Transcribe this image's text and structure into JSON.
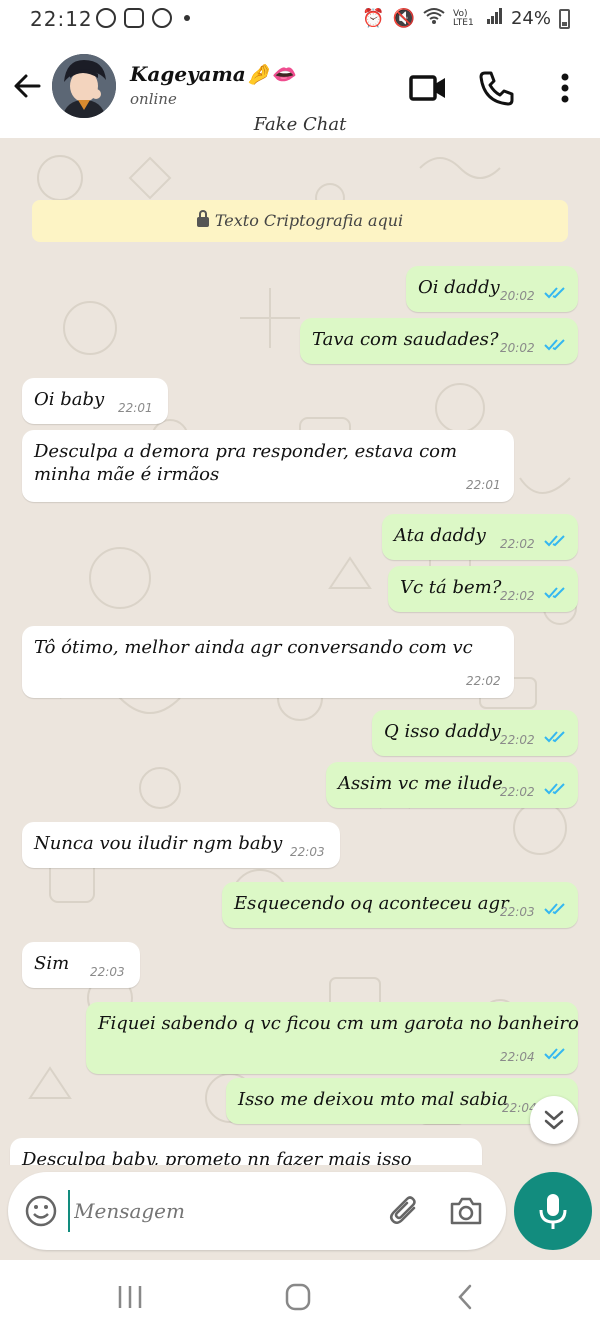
{
  "status_bar": {
    "time": "22:12",
    "network": "Vo) LTE1",
    "battery": "24%"
  },
  "header": {
    "contact_name": "Kageyama🤌👄",
    "contact_status": "online",
    "subtitle": "Fake Chat"
  },
  "chat": {
    "encryption_notice": "Texto Criptografia aqui",
    "messages": [
      {
        "dir": "out",
        "text": "Oi daddy",
        "time": "20:02"
      },
      {
        "dir": "out",
        "text": "Tava com saudades?",
        "time": "20:02"
      },
      {
        "dir": "in",
        "text": "Oi baby",
        "time": "22:01"
      },
      {
        "dir": "in",
        "text": "Desculpa a demora pra responder, estava com\nminha mãe é irmãos",
        "time": "22:01"
      },
      {
        "dir": "out",
        "text": "Ata daddy",
        "time": "22:02"
      },
      {
        "dir": "out",
        "text": "Vc tá bem?",
        "time": "22:02"
      },
      {
        "dir": "in",
        "text": "Tô ótimo, melhor ainda agr conversando com vc",
        "time": "22:02"
      },
      {
        "dir": "out",
        "text": "Q isso daddy",
        "time": "22:02"
      },
      {
        "dir": "out",
        "text": "Assim vc me ilude",
        "time": "22:02"
      },
      {
        "dir": "in",
        "text": "Nunca vou iludir ngm baby",
        "time": "22:03"
      },
      {
        "dir": "out",
        "text": "Esquecendo oq aconteceu agr",
        "time": "22:03"
      },
      {
        "dir": "in",
        "text": "Sim",
        "time": "22:03"
      },
      {
        "dir": "out",
        "text": "Fiquei sabendo q vc ficou cm um garota no banheiro",
        "time": "22:04"
      },
      {
        "dir": "out",
        "text": "Isso me deixou mto mal sabia",
        "time": "22:04"
      },
      {
        "dir": "in",
        "text": "Desculpa baby, prometo nn fazer mais isso",
        "time": ""
      }
    ]
  },
  "input": {
    "placeholder": "Mensagem"
  },
  "colors": {
    "accent": "#128c7e",
    "outgoing_bubble": "#dcf8c6",
    "incoming_bubble": "#ffffff",
    "chat_background": "#ece5dd",
    "read_checks": "#34b7f1"
  }
}
